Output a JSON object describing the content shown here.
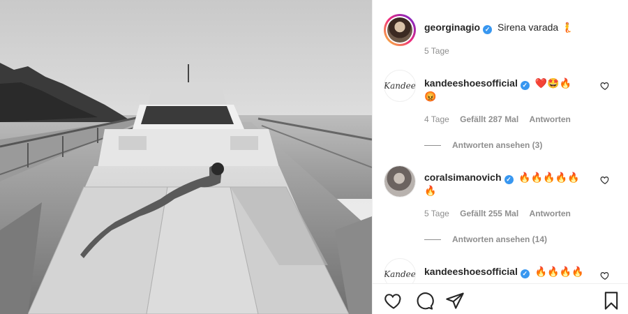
{
  "post": {
    "author": "georginagio",
    "caption": "Sirena varada 🧜",
    "time": "5 Tage"
  },
  "comments": [
    {
      "username": "kandeeshoes",
      "username_full": "kandeeshoesofficial",
      "avatar_text": "Kandee",
      "text": "❤️🤩🔥",
      "text_line2": "😡",
      "time": "4 Tage",
      "likes": "Gefällt 287 Mal",
      "reply": "Antworten",
      "view_replies": "Antworten ansehen (3)"
    },
    {
      "username_full": "coralsimanovich",
      "text": "🔥🔥🔥🔥🔥",
      "text_line2": "🔥",
      "time": "5 Tage",
      "likes": "Gefällt 255 Mal",
      "reply": "Antworten",
      "view_replies": "Antworten ansehen (14)"
    },
    {
      "username_full": "kandeeshoesofficial",
      "avatar_text": "Kandee",
      "text": "🔥🔥🔥🔥"
    }
  ],
  "icons": {
    "verified": "✓",
    "like": "heart-icon",
    "comment": "comment-icon",
    "share": "share-icon",
    "save": "bookmark-icon"
  },
  "colors": {
    "verified": "#3897f0",
    "muted": "#8e8e8e",
    "text": "#262626"
  }
}
